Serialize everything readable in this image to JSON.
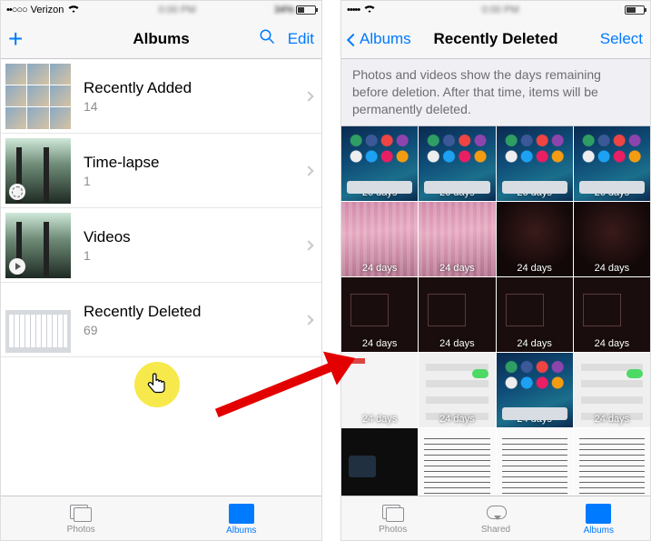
{
  "left": {
    "status": {
      "carrier": "Verizon",
      "signal": "••○○○",
      "wifi": "􀙇",
      "battery_pct": 34
    },
    "nav": {
      "title": "Albums",
      "edit": "Edit"
    },
    "albums": [
      {
        "name": "Recently Added",
        "count": "14"
      },
      {
        "name": "Time-lapse",
        "count": "1"
      },
      {
        "name": "Videos",
        "count": "1"
      },
      {
        "name": "Recently Deleted",
        "count": "69"
      }
    ],
    "tabs": {
      "photos": "Photos",
      "albums": "Albums"
    }
  },
  "right": {
    "status": {
      "carrier": "",
      "signal": "•••••",
      "wifi": "􀙇",
      "battery_pct": 50
    },
    "nav": {
      "back": "Albums",
      "title": "Recently Deleted",
      "select": "Select"
    },
    "info": "Photos and videos show the days remaining before deletion. After that time, items will be permanently deleted.",
    "cells": [
      {
        "days": "26 days",
        "cls": "home"
      },
      {
        "days": "26 days",
        "cls": "home"
      },
      {
        "days": "26 days",
        "cls": "home"
      },
      {
        "days": "26 days",
        "cls": "home"
      },
      {
        "days": "24 days",
        "cls": "pink"
      },
      {
        "days": "24 days",
        "cls": "pink"
      },
      {
        "days": "24 days",
        "cls": "dark"
      },
      {
        "days": "24 days",
        "cls": "dark"
      },
      {
        "days": "24 days",
        "cls": "darker"
      },
      {
        "days": "24 days",
        "cls": "darker"
      },
      {
        "days": "24 days",
        "cls": "darker"
      },
      {
        "days": "24 days",
        "cls": "darker"
      },
      {
        "days": "24 days",
        "cls": "whiteish"
      },
      {
        "days": "24 days",
        "cls": "settings"
      },
      {
        "days": "24 days",
        "cls": "home"
      },
      {
        "days": "24 days",
        "cls": "settings"
      },
      {
        "days": "",
        "cls": "black"
      },
      {
        "days": "",
        "cls": "text"
      },
      {
        "days": "",
        "cls": "text"
      },
      {
        "days": "",
        "cls": "text"
      }
    ],
    "tabs": {
      "photos": "Photos",
      "shared": "Shared",
      "albums": "Albums"
    }
  }
}
